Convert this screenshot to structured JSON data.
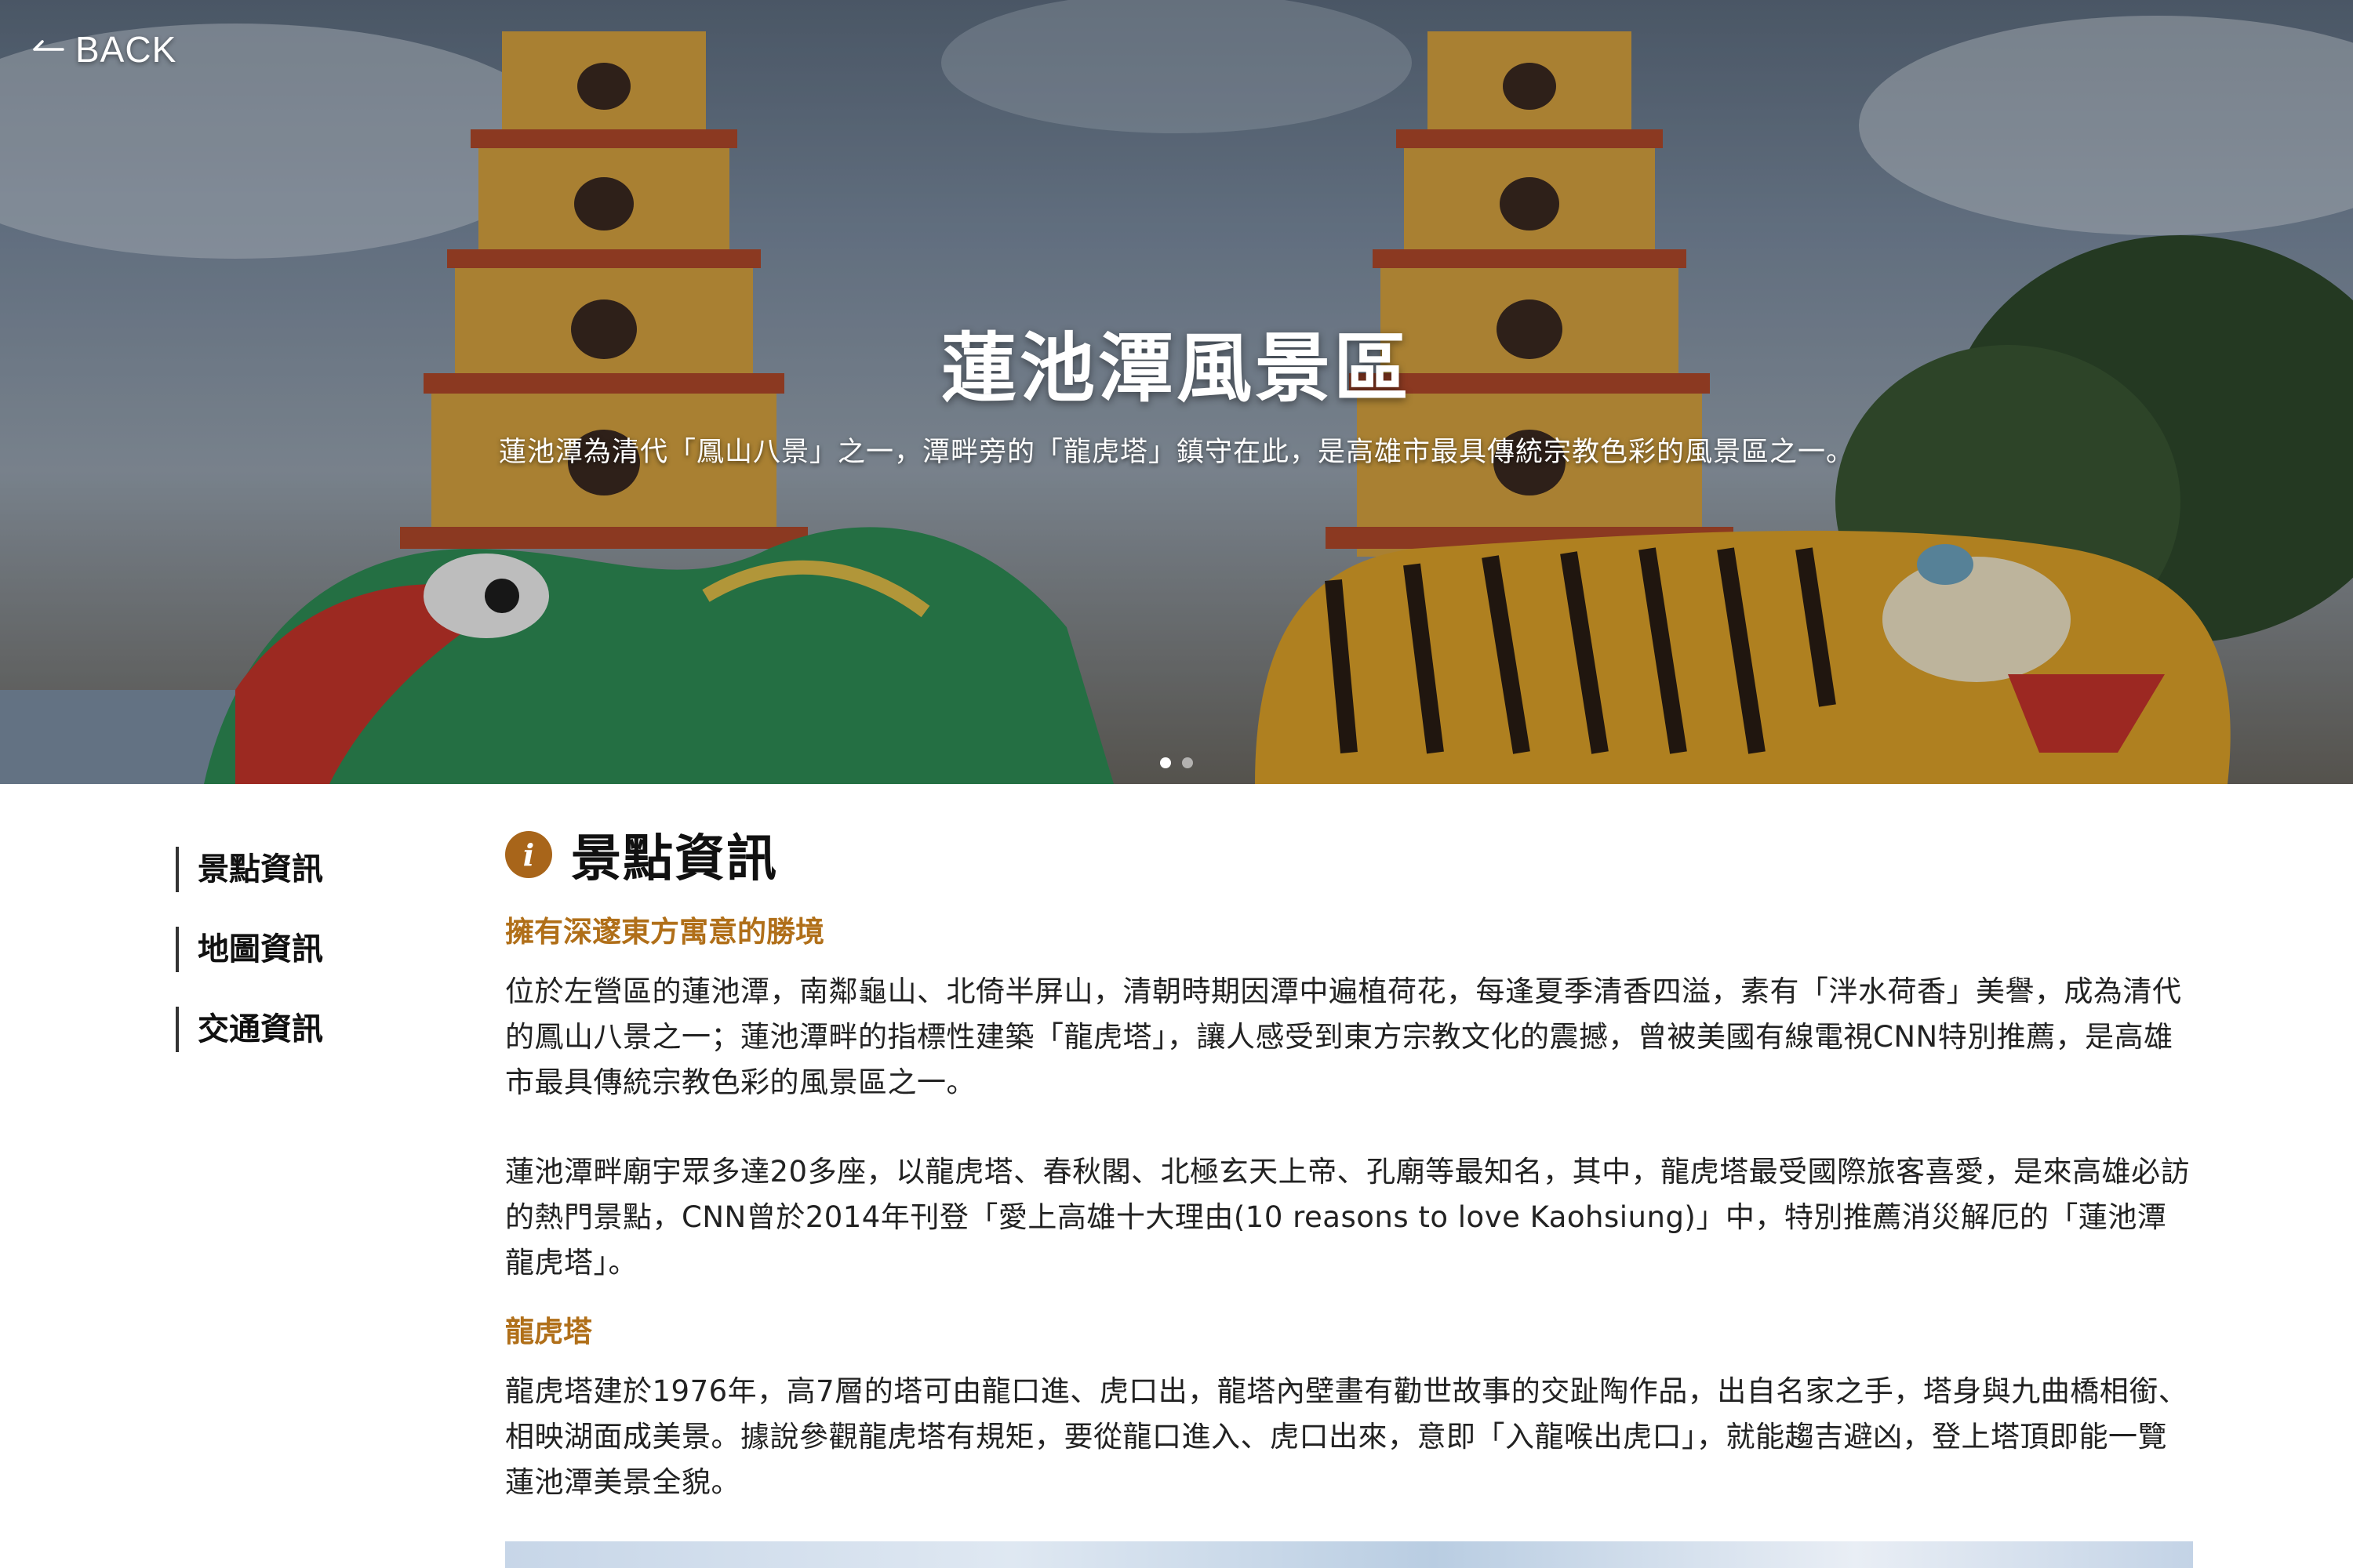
{
  "hero": {
    "back_label": "BACK",
    "title": "蓮池潭風景區",
    "subtitle": "蓮池潭為清代「鳳山八景」之一，潭畔旁的「龍虎塔」鎮守在此，是高雄市最具傳統宗教色彩的風景區之一。",
    "active_slide": 1,
    "slide_count": 2
  },
  "sidebar": {
    "items": [
      {
        "label": "景點資訊"
      },
      {
        "label": "地圖資訊"
      },
      {
        "label": "交通資訊"
      }
    ]
  },
  "main": {
    "section_title": "景點資訊",
    "info_icon_glyph": "i",
    "blocks": [
      {
        "heading": "擁有深邃東方寓意的勝境",
        "paragraphs": [
          "位於左營區的蓮池潭，南鄰龜山、北倚半屏山，清朝時期因潭中遍植荷花，每逢夏季清香四溢，素有「泮水荷香」美譽，成為清代的鳳山八景之一；蓮池潭畔的指標性建築「龍虎塔」，讓人感受到東方宗教文化的震撼，曾被美國有線電視CNN特別推薦，是高雄市最具傳統宗教色彩的風景區之一。",
          "蓮池潭畔廟宇眾多達20多座，以龍虎塔、春秋閣、北極玄天上帝、孔廟等最知名，其中，龍虎塔最受國際旅客喜愛，是來高雄必訪的熱門景點，CNN曾於2014年刊登「愛上高雄十大理由(10 reasons to love Kaohsiung)」中，特別推薦消災解厄的「蓮池潭龍虎塔」。"
        ]
      },
      {
        "heading": "龍虎塔",
        "paragraphs": [
          "龍虎塔建於1976年，高7層的塔可由龍口進、虎口出，龍塔內壁畫有勸世故事的交趾陶作品，出自名家之手，塔身與九曲橋相銜、相映湖面成美景。據說參觀龍虎塔有規矩，要從龍口進入、虎口出來，意即「入龍喉出虎口」，就能趨吉避凶，登上塔頂即能一覽蓮池潭美景全貌。"
        ]
      }
    ]
  },
  "colors": {
    "accent": "#b06f19",
    "icon_bg": "#a8651a",
    "text": "#222222"
  },
  "icons": {
    "back": "left-arrow-icon",
    "info": "info-icon"
  }
}
